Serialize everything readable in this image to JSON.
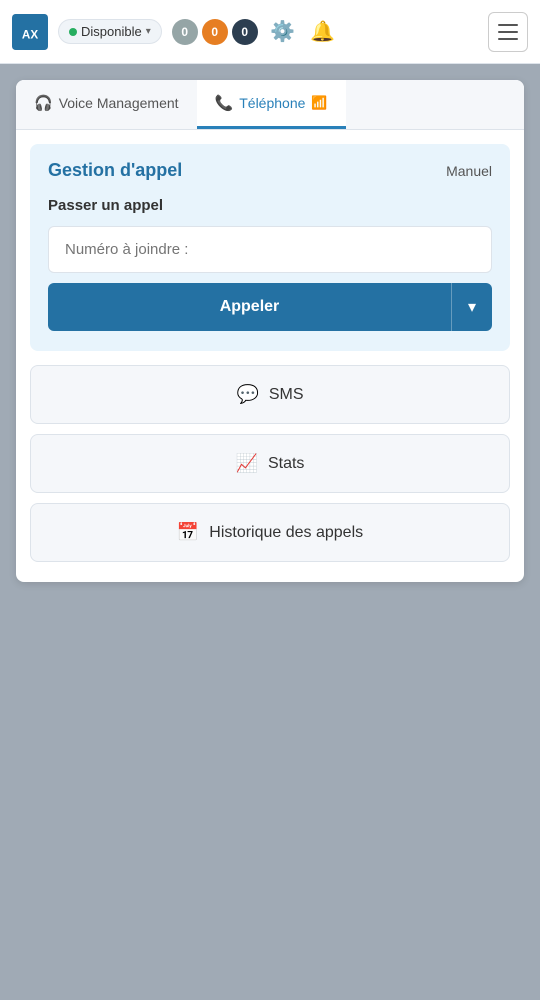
{
  "navbar": {
    "logo_alt": "Axialys",
    "status_label": "Disponible",
    "status_color": "#27ae60",
    "counters": [
      {
        "value": "0",
        "color": "gray"
      },
      {
        "value": "0",
        "color": "orange"
      },
      {
        "value": "0",
        "color": "dark"
      }
    ],
    "hamburger_label": "Menu"
  },
  "tabs": [
    {
      "id": "voice",
      "label": "Voice Management",
      "icon": "🎧",
      "active": false
    },
    {
      "id": "telephone",
      "label": "Téléphone",
      "icon": "📞",
      "active": true
    }
  ],
  "gestion": {
    "title": "Gestion d'appel",
    "mode": "Manuel",
    "passer_label": "Passer un appel",
    "input_placeholder": "Numéro à joindre :",
    "call_button_label": "Appeler"
  },
  "action_buttons": [
    {
      "id": "sms",
      "label": "SMS",
      "icon": "💬"
    },
    {
      "id": "stats",
      "label": "Stats",
      "icon": "📈"
    },
    {
      "id": "historique",
      "label": "Historique des appels",
      "icon": "📅"
    }
  ]
}
